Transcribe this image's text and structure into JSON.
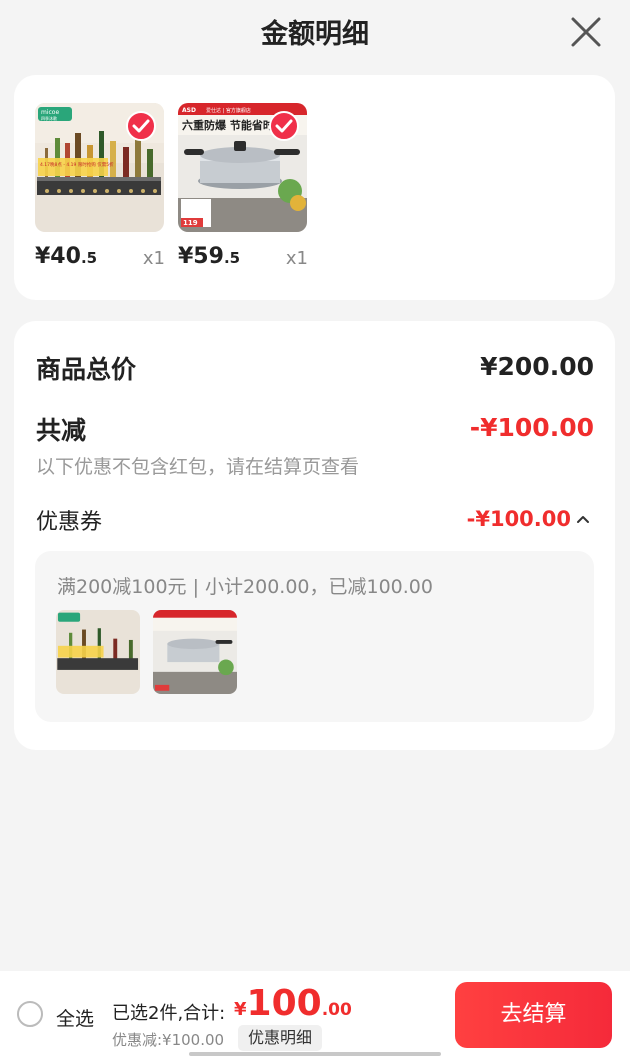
{
  "header": {
    "title": "金额明细"
  },
  "products": [
    {
      "price_int": "¥40",
      "price_dec": ".5",
      "qty": "x1",
      "brand": "micoe",
      "brand_sub": "四季沐歌",
      "promo": "4.17晚8点 - 4.19 限时抢购 仅需5折"
    },
    {
      "price_int": "¥59",
      "price_dec": ".5",
      "qty": "x1",
      "brand": "ASD",
      "brand_sub": "爱仕达 | 官方旗舰店",
      "slogan": "六重防爆  节能省时",
      "tag": "119"
    }
  ],
  "summary": {
    "total_label": "商品总价",
    "total_value": "¥200.00",
    "reduce_label": "共减",
    "reduce_value": "-¥100.00",
    "note": "以下优惠不包含红包，请在结算页查看",
    "coupon_label": "优惠券",
    "coupon_value": "-¥100.00",
    "coupon_desc": "满200减100元 | 小计200.00，已减100.00"
  },
  "bottom": {
    "select_all": "全选",
    "selected_text": "已选2件,合计:",
    "currency": "¥",
    "amount_int": "100",
    "amount_dec": ".00",
    "discount_text": "优惠减:¥100.00",
    "detail_label": "优惠明细",
    "checkout_label": "去结算"
  },
  "colors": {
    "accent": "#f02d2d",
    "checkout": "#f52a3a"
  }
}
